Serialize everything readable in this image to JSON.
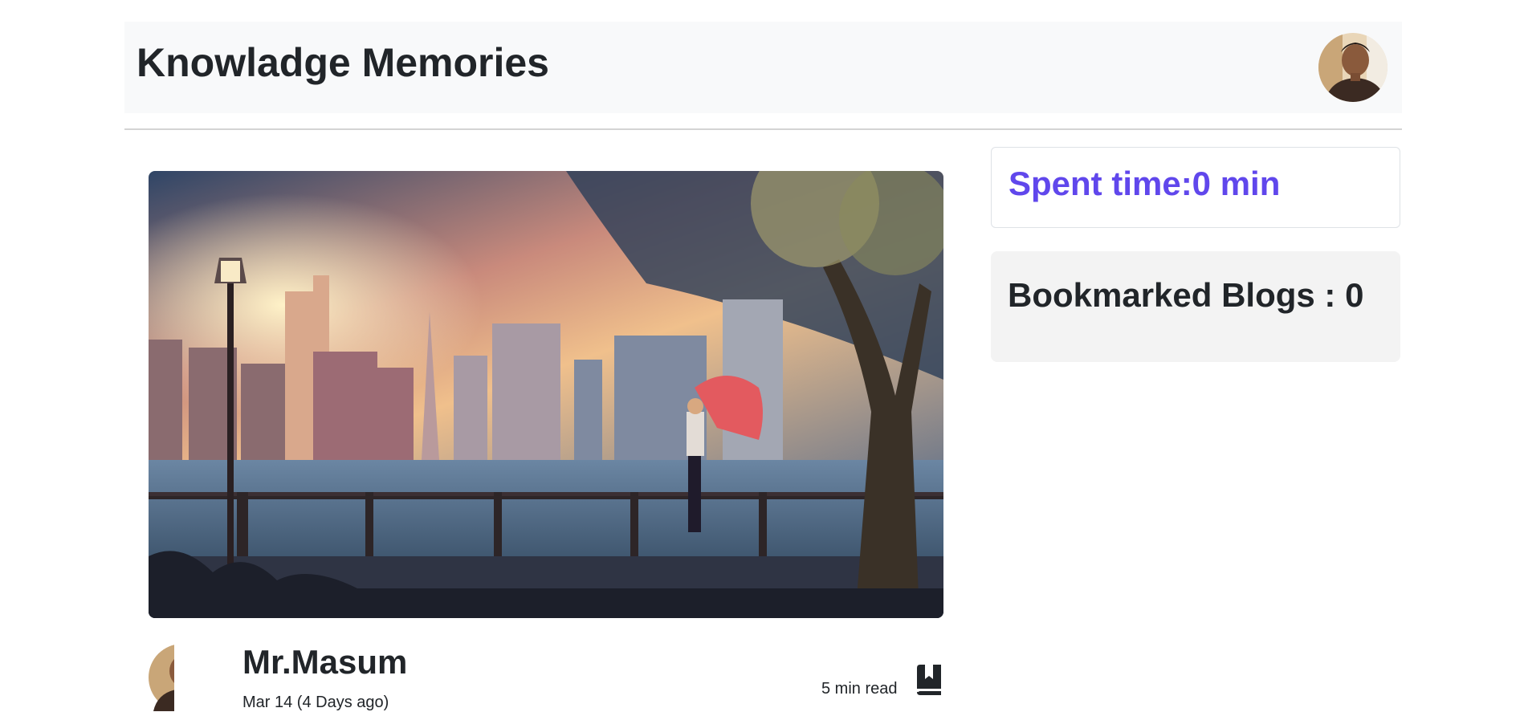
{
  "header": {
    "title": "Knowladge Memories",
    "avatar_icon": "user-avatar-photo"
  },
  "post": {
    "cover_image": "anime-city-riverside-rain-umbrella-illustration",
    "author": {
      "name": "Mr.Masum",
      "avatar_icon": "author-avatar-photo"
    },
    "date": "Mar 14 (4 Days ago)",
    "read_time": "5 min read",
    "bookmark_icon": "bookmark-book-icon"
  },
  "sidebar": {
    "spent_time": "Spent time:0 min",
    "bookmarked": "Bookmarked Blogs : 0"
  },
  "colors": {
    "accent": "#6047ec",
    "header_bg": "#f8f9fa",
    "bookmarks_bg": "#f3f3f3",
    "text": "#212529"
  }
}
